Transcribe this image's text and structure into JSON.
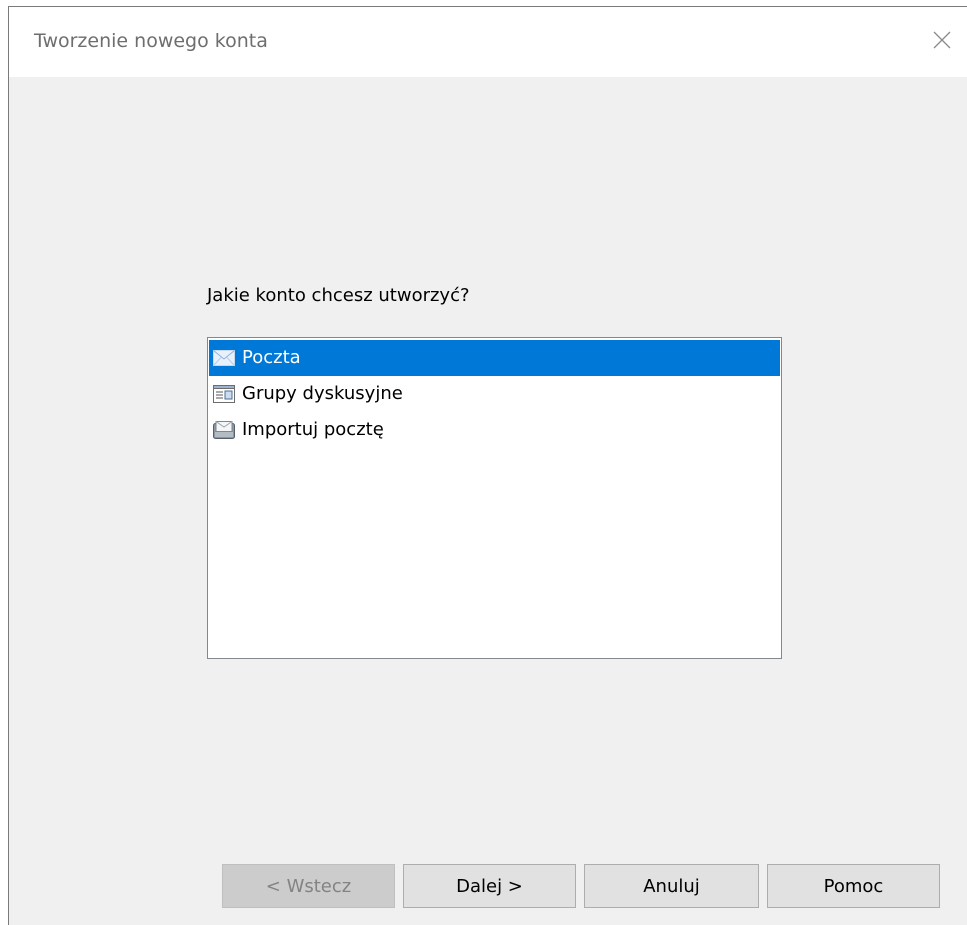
{
  "window": {
    "title": "Tworzenie nowego konta"
  },
  "content": {
    "prompt": "Jakie konto chcesz utworzyć?",
    "account_types": [
      {
        "label": "Poczta",
        "icon": "mail-icon",
        "selected": true
      },
      {
        "label": "Grupy dyskusyjne",
        "icon": "newsgroup-icon",
        "selected": false
      },
      {
        "label": "Importuj pocztę",
        "icon": "import-mail-icon",
        "selected": false
      }
    ]
  },
  "buttons": {
    "back_label": "< Wstecz",
    "back_disabled": true,
    "next_label": "Dalej >",
    "cancel_label": "Anuluj",
    "help_label": "Pomoc"
  },
  "colors": {
    "selection": "#0078d7",
    "dialog_bg": "#f0f0f0",
    "title_bg": "#ffffff"
  }
}
